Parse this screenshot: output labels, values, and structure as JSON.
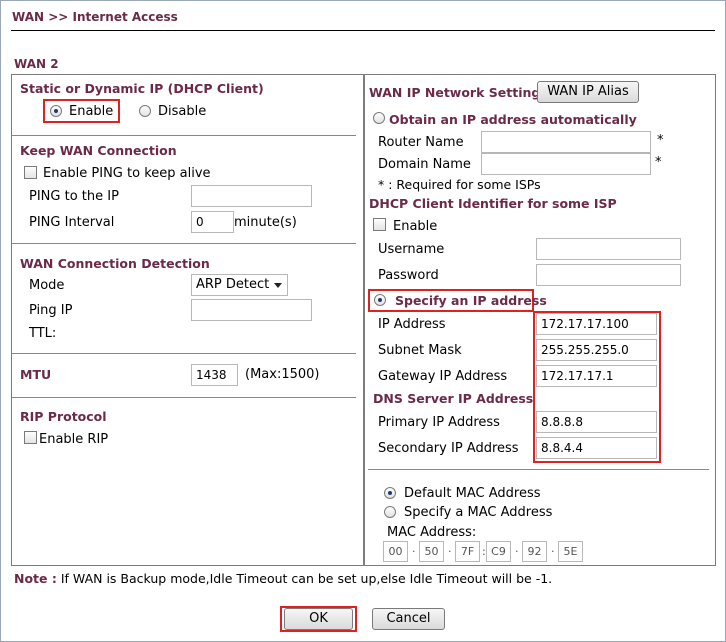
{
  "header": {
    "title": "WAN >> Internet Access"
  },
  "wan_label": "WAN 2",
  "left": {
    "static_dynamic": {
      "title": "Static or Dynamic IP (DHCP Client)",
      "enable_label": "Enable",
      "disable_label": "Disable",
      "selected": "Enable"
    },
    "keep_wan": {
      "title": "Keep WAN Connection",
      "enable_ping_label": "Enable PING to keep alive",
      "ping_ip_label": "PING to the IP",
      "ping_ip_value": "",
      "ping_interval_label": "PING Interval",
      "ping_interval_value": "0",
      "ping_interval_unit": "minute(s)"
    },
    "detection": {
      "title": "WAN Connection Detection",
      "mode_label": "Mode",
      "mode_value": "ARP Detect",
      "ping_ip_label": "Ping IP",
      "ping_ip_value": "",
      "ttl_label": "TTL:"
    },
    "mtu": {
      "label": "MTU",
      "value": "1438",
      "max": "(Max:1500)"
    },
    "rip": {
      "title": "RIP Protocol",
      "enable_label": "Enable RIP"
    }
  },
  "right": {
    "wan_ip_settings": {
      "title": "WAN IP Network Settings",
      "alias_button": "WAN IP Alias"
    },
    "obtain_auto": {
      "label": "Obtain an IP address automatically",
      "router_name_label": "Router Name",
      "domain_name_label": "Domain Name",
      "asterisk": "*",
      "required_note": "* : Required for some ISPs"
    },
    "dhcp_client_id": {
      "title": "DHCP Client Identifier for some ISP",
      "enable_label": "Enable",
      "username_label": "Username",
      "password_label": "Password"
    },
    "specify_ip": {
      "label": "Specify an IP address",
      "ip_label": "IP Address",
      "ip_value": "172.17.17.100",
      "mask_label": "Subnet Mask",
      "mask_value": "255.255.255.0",
      "gateway_label": "Gateway IP Address",
      "gateway_value": "172.17.17.1"
    },
    "dns": {
      "title": "DNS Server IP Address",
      "primary_label": "Primary IP Address",
      "primary_value": "8.8.8.8",
      "secondary_label": "Secondary IP Address",
      "secondary_value": "8.8.4.4"
    },
    "mac": {
      "default_label": "Default MAC Address",
      "specify_label": "Specify a MAC Address",
      "address_label": "MAC Address:",
      "octets": [
        "00",
        "50",
        "7F",
        "C9",
        "92",
        "5E"
      ],
      "separators": [
        "·",
        "·",
        ":",
        "·",
        "·"
      ]
    }
  },
  "note": {
    "prefix": "Note :",
    "text": " If WAN is Backup mode,Idle Timeout can be set up,else Idle Timeout will be -1."
  },
  "buttons": {
    "ok": "OK",
    "cancel": "Cancel"
  },
  "colors": {
    "heading": "#6b2a4a",
    "highlight": "#dd2222"
  }
}
